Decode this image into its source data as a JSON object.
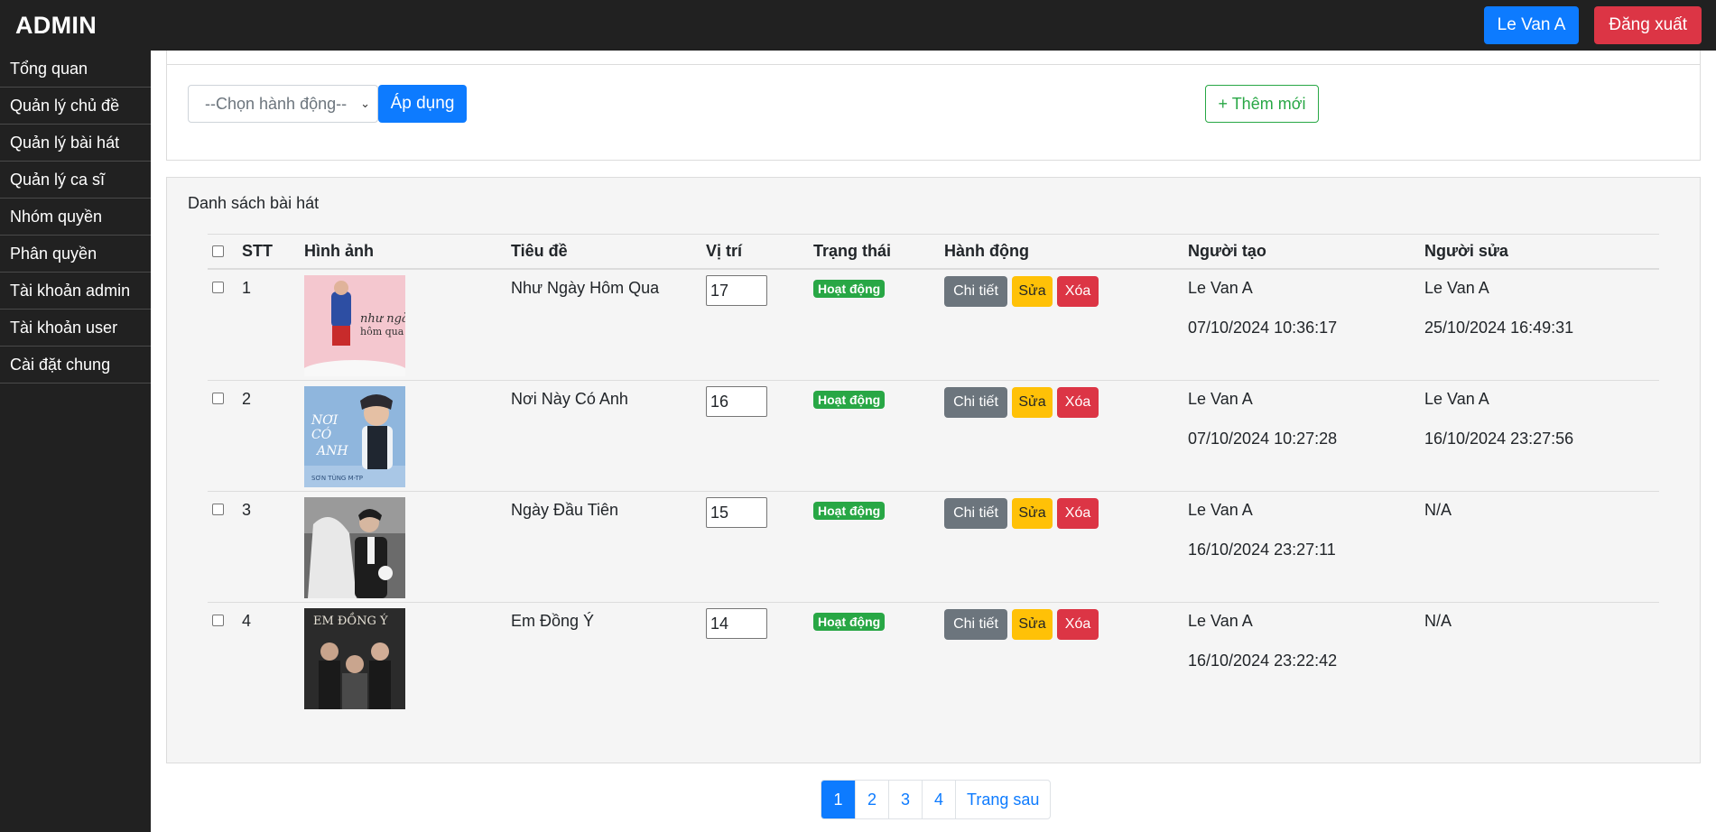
{
  "header": {
    "brand": "ADMIN",
    "user_label": "Le Van A",
    "logout_label": "Đăng xuất"
  },
  "sidebar": {
    "items": [
      {
        "label": "Tổng quan"
      },
      {
        "label": "Quản lý chủ đề"
      },
      {
        "label": "Quản lý bài hát"
      },
      {
        "label": "Quản lý ca sĩ"
      },
      {
        "label": "Nhóm quyền"
      },
      {
        "label": "Phân quyền"
      },
      {
        "label": "Tài khoản admin"
      },
      {
        "label": "Tài khoản user"
      },
      {
        "label": "Cài đặt chung"
      }
    ]
  },
  "toolbar": {
    "action_select": "--Chọn hành động--",
    "apply_label": "Áp dụng",
    "add_label": "+ Thêm mới"
  },
  "list": {
    "title": "Danh sách bài hát",
    "columns": {
      "stt": "STT",
      "image": "Hình ảnh",
      "title": "Tiêu đề",
      "position": "Vị trí",
      "status": "Trạng thái",
      "action": "Hành động",
      "creator": "Người tạo",
      "editor": "Người sửa"
    },
    "buttons": {
      "detail": "Chi tiết",
      "edit": "Sửa",
      "delete": "Xóa"
    },
    "rows": [
      {
        "stt": "1",
        "title": "Như Ngày Hôm Qua",
        "position": "17",
        "status": "Hoạt động",
        "creator": "Le Van A",
        "created_at": "07/10/2024 10:36:17",
        "editor": "Le Van A",
        "edited_at": "25/10/2024 16:49:31"
      },
      {
        "stt": "2",
        "title": "Nơi Này Có Anh",
        "position": "16",
        "status": "Hoạt động",
        "creator": "Le Van A",
        "created_at": "07/10/2024 10:27:28",
        "editor": "Le Van A",
        "edited_at": "16/10/2024 23:27:56"
      },
      {
        "stt": "3",
        "title": "Ngày Đầu Tiên",
        "position": "15",
        "status": "Hoạt động",
        "creator": "Le Van A",
        "created_at": "16/10/2024 23:27:11",
        "editor": "N/A",
        "edited_at": ""
      },
      {
        "stt": "4",
        "title": "Em Đồng Ý",
        "position": "14",
        "status": "Hoạt động",
        "creator": "Le Van A",
        "created_at": "16/10/2024 23:22:42",
        "editor": "N/A",
        "edited_at": ""
      }
    ]
  },
  "pagination": {
    "pages": [
      "1",
      "2",
      "3",
      "4"
    ],
    "current": "1",
    "next_label": "Trang sau"
  }
}
